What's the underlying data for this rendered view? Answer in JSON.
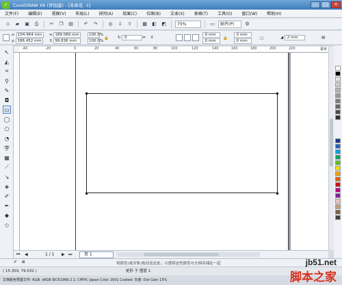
{
  "window": {
    "title": "CorelDRAW X6 (评估版) - [未命名 -1]",
    "min": "–",
    "max": "□",
    "close": "×"
  },
  "menu": [
    "文件(F)",
    "编辑(E)",
    "视图(V)",
    "布局(L)",
    "排列(A)",
    "效果(C)",
    "位图(B)",
    "文本(X)",
    "表格(T)",
    "工具(O)",
    "窗口(W)",
    "帮助(H)"
  ],
  "toolbar": {
    "zoom": "75%",
    "snap": "贴齐(P)"
  },
  "props": {
    "x": "104.964 mm",
    "y": "186.452 mm",
    "w": "189.089 mm",
    "h": "99.836 mm",
    "scale_x": "100.0",
    "scale_y": "100.0",
    "pct": "%",
    "angle": ".0",
    "corner_a": ".0 mm",
    "corner_b": ".0 mm",
    "corner_c": ".0 mm",
    "corner_d": ".0 mm",
    "outline": ".2 mm"
  },
  "ruler": {
    "unit": "毫米",
    "ticks": [
      "-40",
      "-20",
      "0",
      "20",
      "40",
      "60",
      "80",
      "100",
      "120",
      "140",
      "160",
      "180",
      "200",
      "220"
    ]
  },
  "page_nav": {
    "count": "1 / 1",
    "tab": "页 1"
  },
  "status": {
    "coords": "( 15.359, 79.032 )",
    "object": "矩形 于 图层 1",
    "hint": "将颜色(或对象)拖动至此处，以便将这些颜色与文档存储在一起",
    "profile": "文档颜色预置文件: RGB: sRGB IEC61966-2.1; CMYK: Japan Color 2001 Coated; 灰度: Dot Gain 15%"
  },
  "watermark": {
    "url": "jb51.net",
    "text": "脚本之家"
  },
  "colors": {
    "accent": "#3f7dbd",
    "palette": [
      "#ffffff",
      "#000000",
      "#e6e6e6",
      "#cccccc",
      "#b3b3b3",
      "#999999",
      "#808080",
      "#666666",
      "#4d4d4d",
      "#333333",
      "#1a3a8f",
      "#2060c0",
      "#00a0e0",
      "#00a060",
      "#60c020",
      "#f0e000",
      "#f0a000",
      "#e06010",
      "#d01010",
      "#c00080",
      "#8020a0",
      "#f0c0c0",
      "#c0a080",
      "#806040",
      "#404040"
    ]
  }
}
